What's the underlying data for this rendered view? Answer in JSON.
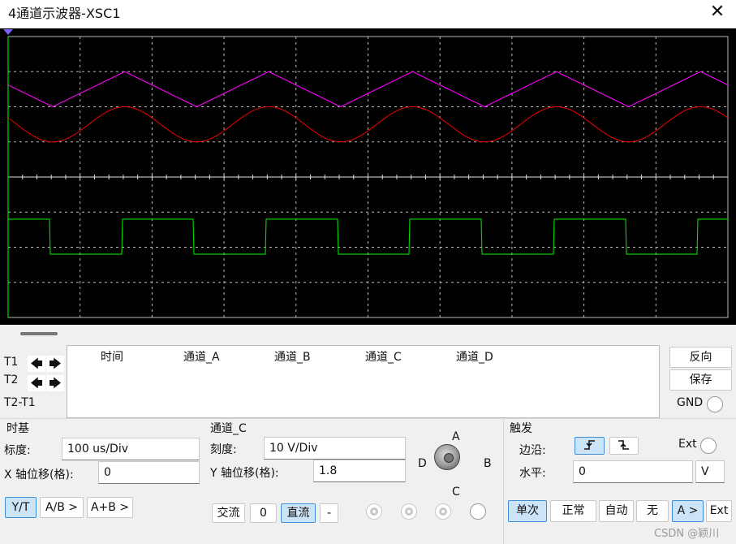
{
  "window": {
    "title": "4通道示波器-XSC1",
    "close_glyph": "✕"
  },
  "cursors": {
    "t1_label": "T1",
    "t2_label": "T2",
    "diff_label": "T2-T1",
    "left_arrow": "🡄",
    "right_arrow": "🡆",
    "columns": [
      "时间",
      "通道_A",
      "通道_B",
      "通道_C",
      "通道_D"
    ]
  },
  "side_buttons": {
    "reverse": "反向",
    "save": "保存",
    "gnd": "GND"
  },
  "timebase": {
    "title": "时基",
    "scale_label": "标度:",
    "scale_value": "100 us/Div",
    "xpos_label": "X 轴位移(格):",
    "xpos_value": "0",
    "mode_yt": "Y/T",
    "mode_ab": "A/B >",
    "mode_apb": "A+B >"
  },
  "channel": {
    "title": "通道_C",
    "scale_label": "刻度:",
    "scale_value": "10  V/Div",
    "ypos_label": "Y 轴位移(格):",
    "ypos_value": "1.8",
    "ac": "交流",
    "zero": "0",
    "dc": "直流",
    "minus": "-",
    "knob_A": "A",
    "knob_B": "B",
    "knob_C": "C",
    "knob_D": "D"
  },
  "trigger": {
    "title": "触发",
    "edge_label": "边沿:",
    "ext_label": "Ext",
    "level_label": "水平:",
    "level_value": "0",
    "level_unit": "V",
    "single": "单次",
    "normal": "正常",
    "auto": "自动",
    "none": "无",
    "source": "A >",
    "ext": "Ext",
    "rising_icon": "rising-edge",
    "falling_icon": "falling-edge"
  },
  "watermark": "CSDN @颖川",
  "colors": {
    "triangle": "#ff00ff",
    "sine": "#e00000",
    "square": "#00dd00",
    "grid": "#b8b8b8",
    "screen": "#000000"
  },
  "waveforms": {
    "period_div": 2,
    "triangle": {
      "top_div": 7.0,
      "bottom_div": 6.0
    },
    "sine": {
      "center_div": 5.5,
      "amplitude_div": 0.5
    },
    "square": {
      "high_div": 2.8,
      "low_div": 1.8
    }
  }
}
